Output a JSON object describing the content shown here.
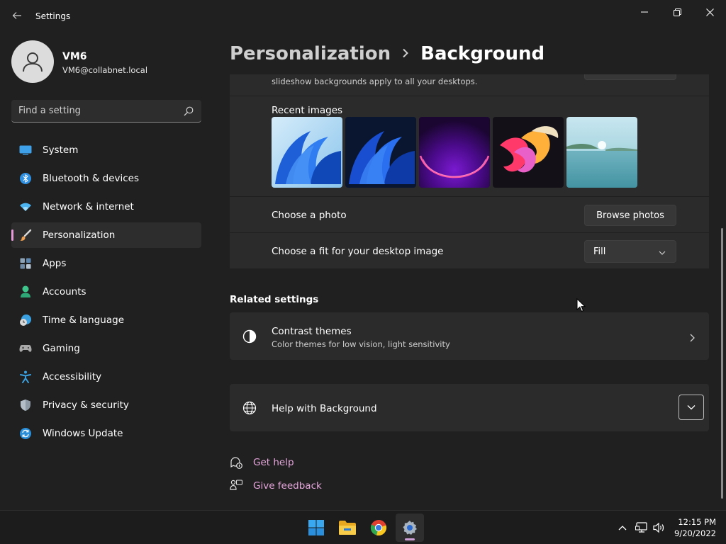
{
  "window": {
    "title": "Settings",
    "back_icon": "back-arrow-icon",
    "controls": [
      "minimize-icon",
      "restore-icon",
      "close-icon"
    ]
  },
  "profile": {
    "name": "VM6",
    "email": "VM6@collabnet.local"
  },
  "search": {
    "placeholder": "Find a setting"
  },
  "sidebar": {
    "items": [
      {
        "label": "System",
        "icon": "system-icon"
      },
      {
        "label": "Bluetooth & devices",
        "icon": "bluetooth-icon"
      },
      {
        "label": "Network & internet",
        "icon": "network-icon"
      },
      {
        "label": "Personalization",
        "icon": "brush-icon",
        "active": true
      },
      {
        "label": "Apps",
        "icon": "apps-icon"
      },
      {
        "label": "Accounts",
        "icon": "accounts-icon"
      },
      {
        "label": "Time & language",
        "icon": "time-language-icon"
      },
      {
        "label": "Gaming",
        "icon": "gaming-icon"
      },
      {
        "label": "Accessibility",
        "icon": "accessibility-icon"
      },
      {
        "label": "Privacy & security",
        "icon": "shield-icon"
      },
      {
        "label": "Windows Update",
        "icon": "update-icon"
      }
    ]
  },
  "header": {
    "parent": "Personalization",
    "current": "Background"
  },
  "main": {
    "slideshow_note": "slideshow backgrounds apply to all your desktops.",
    "recent_images_label": "Recent images",
    "recent_images": [
      "bloom-blue-light",
      "bloom-blue-dark",
      "glow-purple",
      "ribbon-colorful",
      "lake-landscape"
    ],
    "choose_photo_label": "Choose a photo",
    "browse_button": "Browse photos",
    "choose_fit_label": "Choose a fit for your desktop image",
    "fit_value": "Fill",
    "related_title": "Related settings",
    "contrast_title": "Contrast themes",
    "contrast_desc": "Color themes for low vision, light sensitivity",
    "help_title": "Help with Background",
    "get_help": "Get help",
    "give_feedback": "Give feedback"
  },
  "taskbar": {
    "apps": [
      "start-icon",
      "file-explorer-icon",
      "chrome-icon",
      "settings-icon"
    ],
    "time": "12:15 PM",
    "date": "9/20/2022"
  },
  "colors": {
    "accent": "#e6a6dc",
    "background": "#202020",
    "card": "#2b2b2b"
  }
}
